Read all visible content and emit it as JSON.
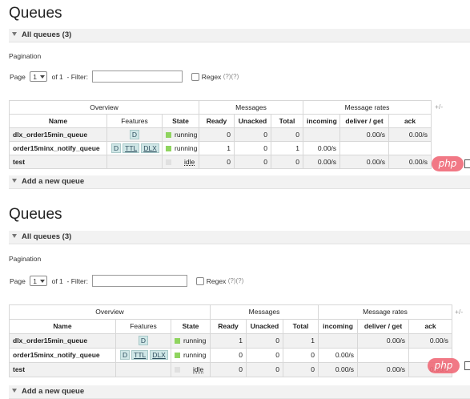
{
  "screens": [
    {
      "title": "Queues",
      "all_queues_label": "All queues (3)",
      "pagination_label": "Pagination",
      "pager": {
        "page_label": "Page",
        "page_value": "1",
        "of_label": "of 1",
        "filter_label": "- Filter:",
        "filter_value": "",
        "regex_label": "Regex",
        "regex_hint": "(?)(?)"
      },
      "group_headers": {
        "overview": "Overview",
        "messages": "Messages",
        "rates": "Message rates"
      },
      "plus_minus": "+/-",
      "columns": {
        "name": "Name",
        "features": "Features",
        "state": "State",
        "ready": "Ready",
        "unacked": "Unacked",
        "total": "Total",
        "incoming": "incoming",
        "deliver_get": "deliver / get",
        "ack": "ack"
      },
      "rows": [
        {
          "name": "dlx_order15min_queue",
          "features": [
            "D"
          ],
          "state": "running",
          "ready": "0",
          "unacked": "0",
          "total": "0",
          "incoming": "",
          "deliver_get": "0.00/s",
          "ack": "0.00/s"
        },
        {
          "name": "order15minx_notify_queue",
          "features": [
            "D",
            "TTL",
            "DLX"
          ],
          "state": "running",
          "ready": "1",
          "unacked": "0",
          "total": "1",
          "incoming": "0.00/s",
          "deliver_get": "",
          "ack": ""
        },
        {
          "name": "test",
          "features": [],
          "state": "idle",
          "ready": "0",
          "unacked": "0",
          "total": "0",
          "incoming": "0.00/s",
          "deliver_get": "0.00/s",
          "ack": "0.00/s"
        }
      ],
      "add_queue_label": "Add a new queue",
      "watermark": "php"
    },
    {
      "title": "Queues",
      "all_queues_label": "All queues (3)",
      "pagination_label": "Pagination",
      "pager": {
        "page_label": "Page",
        "page_value": "1",
        "of_label": "of 1",
        "filter_label": "- Filter:",
        "filter_value": "",
        "regex_label": "Regex",
        "regex_hint": "(?)(?)"
      },
      "group_headers": {
        "overview": "Overview",
        "messages": "Messages",
        "rates": "Message rates"
      },
      "plus_minus": "+/-",
      "columns": {
        "name": "Name",
        "features": "Features",
        "state": "State",
        "ready": "Ready",
        "unacked": "Unacked",
        "total": "Total",
        "incoming": "incoming",
        "deliver_get": "deliver / get",
        "ack": "ack"
      },
      "rows": [
        {
          "name": "dlx_order15min_queue",
          "features": [
            "D"
          ],
          "state": "running",
          "ready": "1",
          "unacked": "0",
          "total": "1",
          "incoming": "",
          "deliver_get": "0.00/s",
          "ack": "0.00/s"
        },
        {
          "name": "order15minx_notify_queue",
          "features": [
            "D",
            "TTL",
            "DLX"
          ],
          "state": "running",
          "ready": "0",
          "unacked": "0",
          "total": "0",
          "incoming": "0.00/s",
          "deliver_get": "",
          "ack": ""
        },
        {
          "name": "test",
          "features": [],
          "state": "idle",
          "ready": "0",
          "unacked": "0",
          "total": "0",
          "incoming": "0.00/s",
          "deliver_get": "0.00/s",
          "ack": "0.00/s"
        }
      ],
      "add_queue_label": "Add a new queue",
      "watermark": "php"
    }
  ],
  "colors": {
    "running": "#8fd45f",
    "idle": "#e0e0e0",
    "feature_tag": "#cfe6e6",
    "watermark": "#f06a78"
  },
  "icons": {
    "collapse": "triangle-down-icon",
    "select": "chevron-down-icon"
  }
}
